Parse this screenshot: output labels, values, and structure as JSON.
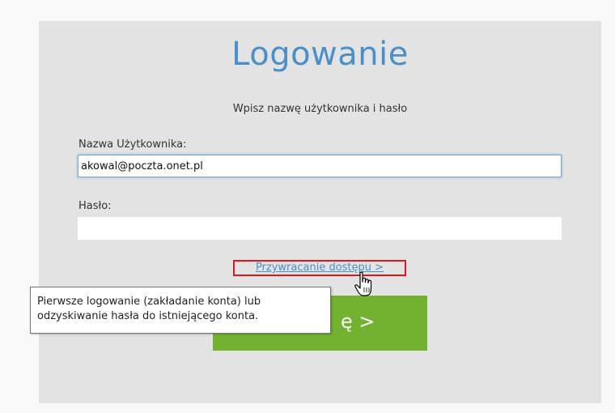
{
  "login": {
    "title": "Logowanie",
    "subtitle": "Wpisz nazwę użytkownika i hasło",
    "username_label": "Nazwa Użytkownika:",
    "username_value": "akowal@poczta.onet.pl",
    "password_label": "Hasło:",
    "password_value": "",
    "recover_link": "Przywracanie dostępu >",
    "button_label": "ę >"
  },
  "tooltip": {
    "line1": "Pierwsze logowanie (zakładanie konta) lub",
    "line2": "odzyskiwanie hasła do istniejącego konta."
  },
  "cursor": {
    "icon": "hand-pointer-icon"
  },
  "colors": {
    "title": "#4a8fc8",
    "link": "#4a8fc8",
    "highlight_border": "#e0161b",
    "button": "#72b230",
    "panel": "#e3e3e3"
  }
}
